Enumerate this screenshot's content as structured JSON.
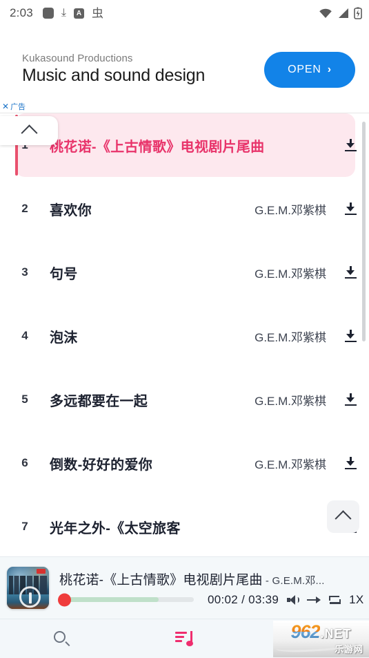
{
  "statusbar": {
    "time": "2:03",
    "left_icons": [
      "app-square-icon",
      "download-icon",
      "a-box-icon",
      "bug-icon"
    ],
    "right_icons": [
      "wifi-icon",
      "signal-icon",
      "battery-charging-icon"
    ],
    "a_box_label": "A",
    "bug_glyph": "虫",
    "download_glyph": "⤓"
  },
  "ad": {
    "advertiser": "Kukasound Productions",
    "headline": "Music and sound design",
    "cta_label": "OPEN",
    "cta_chevron": "›",
    "badge_close": "✕",
    "badge_label": "广告",
    "cta_color": "#1283e8"
  },
  "list": {
    "collapse_tab_icon": "chevron-up-icon",
    "scroll_to_top_icon": "chevron-up-icon",
    "download_icon_label": "download-icon",
    "active_title_color": "#e8336a",
    "active_row_bg": "#fde8ee",
    "accent_color": "#e9506d",
    "songs": [
      {
        "num": "1",
        "title": "桃花诺-《上古情歌》电视剧片尾曲",
        "artist": "",
        "active": true
      },
      {
        "num": "2",
        "title": "喜欢你",
        "artist": "G.E.M.邓紫棋",
        "active": false
      },
      {
        "num": "3",
        "title": "句号",
        "artist": "G.E.M.邓紫棋",
        "active": false
      },
      {
        "num": "4",
        "title": "泡沫",
        "artist": "G.E.M.邓紫棋",
        "active": false
      },
      {
        "num": "5",
        "title": "多远都要在一起",
        "artist": "G.E.M.邓紫棋",
        "active": false
      },
      {
        "num": "6",
        "title": "倒数-好好的爱你",
        "artist": "G.E.M.邓紫棋",
        "active": false
      },
      {
        "num": "7",
        "title": "光年之外-《太空旅客",
        "artist": "",
        "active": false
      }
    ]
  },
  "player": {
    "cover_alt": "album-cover",
    "title": "桃花诺-《上古情歌》电视剧片尾曲",
    "artist_suffix": " - G.E.M.邓...",
    "elapsed": "00:02",
    "separator": " / ",
    "duration": "03:39",
    "time_display": "00:02 / 03:39",
    "speed_label": "1X",
    "progress_percent": 1,
    "buffered_percent": 74,
    "thumb_color": "#ef3c3c",
    "buffer_color": "#bfe0c9",
    "icons": [
      "volume-icon",
      "next-arrow-icon",
      "repeat-icon"
    ]
  },
  "bottomnav": {
    "items": [
      {
        "name": "search-icon",
        "active": false
      },
      {
        "name": "playlist-music-icon",
        "active": true
      }
    ],
    "active_color": "#ef2d6e",
    "watermark": {
      "number": "962",
      "domain": ".NET",
      "chinese": "乐游网"
    }
  }
}
